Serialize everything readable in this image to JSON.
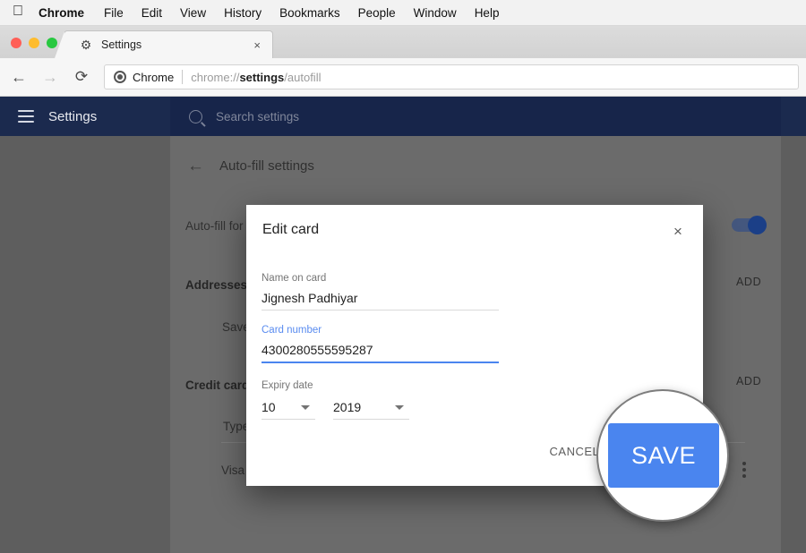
{
  "os_menubar": {
    "apple_icon": "apple-logo",
    "items": [
      {
        "label": "Chrome",
        "bold": true
      },
      {
        "label": "File",
        "bold": false
      },
      {
        "label": "Edit",
        "bold": false
      },
      {
        "label": "View",
        "bold": false
      },
      {
        "label": "History",
        "bold": false
      },
      {
        "label": "Bookmarks",
        "bold": false
      },
      {
        "label": "People",
        "bold": false
      },
      {
        "label": "Window",
        "bold": false
      },
      {
        "label": "Help",
        "bold": false
      }
    ]
  },
  "browser": {
    "tab": {
      "favicon": "gear-icon",
      "title": "Settings",
      "close_label": "×"
    },
    "nav": {
      "back": "←",
      "forward": "→",
      "reload": "⟳"
    },
    "omnibox": {
      "security_chip": "Chrome",
      "url_prefix": "chrome://",
      "url_bold": "settings",
      "url_suffix": "/autofill"
    }
  },
  "settings_header": {
    "menu_icon": "hamburger-icon",
    "title": "Settings",
    "search": {
      "icon": "search-icon",
      "placeholder": "Search settings",
      "value": ""
    }
  },
  "settings_page": {
    "back_arrow": "←",
    "page_title": "Auto-fill settings",
    "rows": {
      "autofill_for": "Auto-fill for",
      "addresses": "Addresses",
      "save": "Save",
      "credit_card": "Credit card",
      "type": "Type",
      "visa": "Visa"
    },
    "add_button_1": "ADD",
    "add_button_2": "ADD",
    "toggle_on": true,
    "kebab_icon": "more-vertical-icon"
  },
  "dialog": {
    "title": "Edit card",
    "close_label": "×",
    "fields": {
      "name_on_card": {
        "label": "Name on card",
        "value": "Jignesh Padhiyar",
        "focused": false
      },
      "card_number": {
        "label": "Card number",
        "value": "4300280555595287",
        "focused": true
      },
      "expiry": {
        "label": "Expiry date",
        "month": "10",
        "year": "2019"
      }
    },
    "actions": {
      "cancel": "CANCEL",
      "save": "SAVE"
    }
  },
  "magnifier": {
    "highlighted_button": "SAVE"
  },
  "colors": {
    "accent_blue": "#4a85ef",
    "header_navy": "#1b2a4e",
    "search_navy": "#17254a",
    "backdrop_gray": "#5e5e5e",
    "card_gray": "#6b6b6b"
  }
}
